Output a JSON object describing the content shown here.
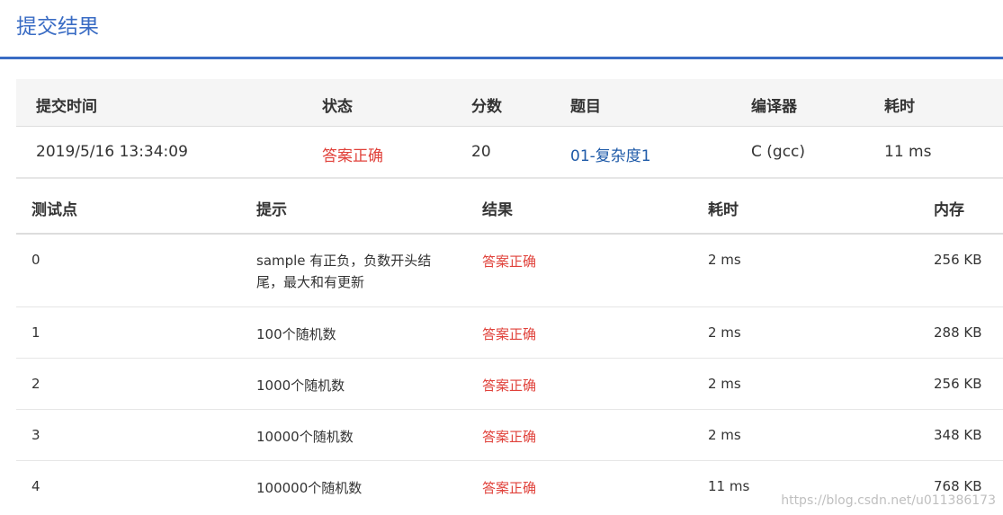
{
  "page": {
    "title": "提交结果"
  },
  "summary": {
    "headers": [
      "提交时间",
      "状态",
      "分数",
      "题目",
      "编译器",
      "耗时"
    ],
    "row": {
      "time": "2019/5/16 13:34:09",
      "status": "答案正确",
      "score": "20",
      "problem": "01-复杂度1",
      "compiler": "C (gcc)",
      "duration": "11 ms"
    }
  },
  "tests": {
    "headers": [
      "测试点",
      "提示",
      "结果",
      "耗时",
      "内存"
    ],
    "rows": [
      {
        "id": "0",
        "hint": "sample 有正负，负数开头结尾，最大和有更新",
        "result": "答案正确",
        "time": "2 ms",
        "memory": "256 KB"
      },
      {
        "id": "1",
        "hint": "100个随机数",
        "result": "答案正确",
        "time": "2 ms",
        "memory": "288 KB"
      },
      {
        "id": "2",
        "hint": "1000个随机数",
        "result": "答案正确",
        "time": "2 ms",
        "memory": "256 KB"
      },
      {
        "id": "3",
        "hint": "10000个随机数",
        "result": "答案正确",
        "time": "2 ms",
        "memory": "348 KB"
      },
      {
        "id": "4",
        "hint": "100000个随机数",
        "result": "答案正确",
        "time": "11 ms",
        "memory": "768 KB"
      }
    ]
  },
  "watermark": "https://blog.csdn.net/u011386173",
  "colors": {
    "accent": "#3a6cc4",
    "success_text": "#e0413a",
    "link": "#1e5aa8"
  }
}
